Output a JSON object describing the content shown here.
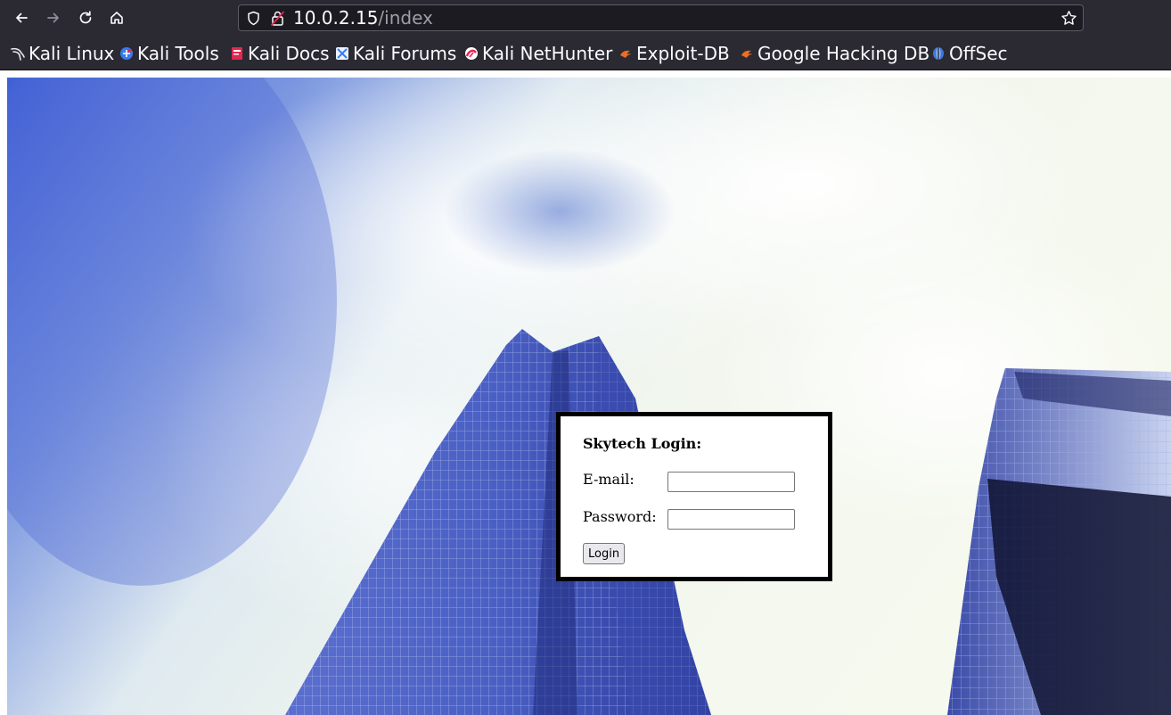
{
  "browser": {
    "url_host": "10.0.2.15",
    "url_path": "/index",
    "bookmarks": [
      {
        "label": "Kali Linux",
        "icon": "kali-dragon-icon"
      },
      {
        "label": "Kali Tools",
        "icon": "kali-tools-icon"
      },
      {
        "label": "Kali Docs",
        "icon": "kali-docs-icon"
      },
      {
        "label": "Kali Forums",
        "icon": "kali-forums-icon"
      },
      {
        "label": "Kali NetHunter",
        "icon": "kali-nethunter-icon"
      },
      {
        "label": "Exploit-DB",
        "icon": "exploit-db-icon"
      },
      {
        "label": "Google Hacking DB",
        "icon": "google-hacking-db-icon"
      },
      {
        "label": "OffSec",
        "icon": "offsec-icon"
      }
    ]
  },
  "login": {
    "title": "Skytech Login:",
    "email_label": "E-mail:",
    "email_value": "",
    "password_label": "Password:",
    "password_value": "",
    "button_label": "Login"
  },
  "colors": {
    "chrome_bg": "#2b2a33",
    "urlbar_bg": "#1c1b22",
    "sky_blue": "#4f6fd8",
    "building_blue": "#3d4fb0"
  }
}
